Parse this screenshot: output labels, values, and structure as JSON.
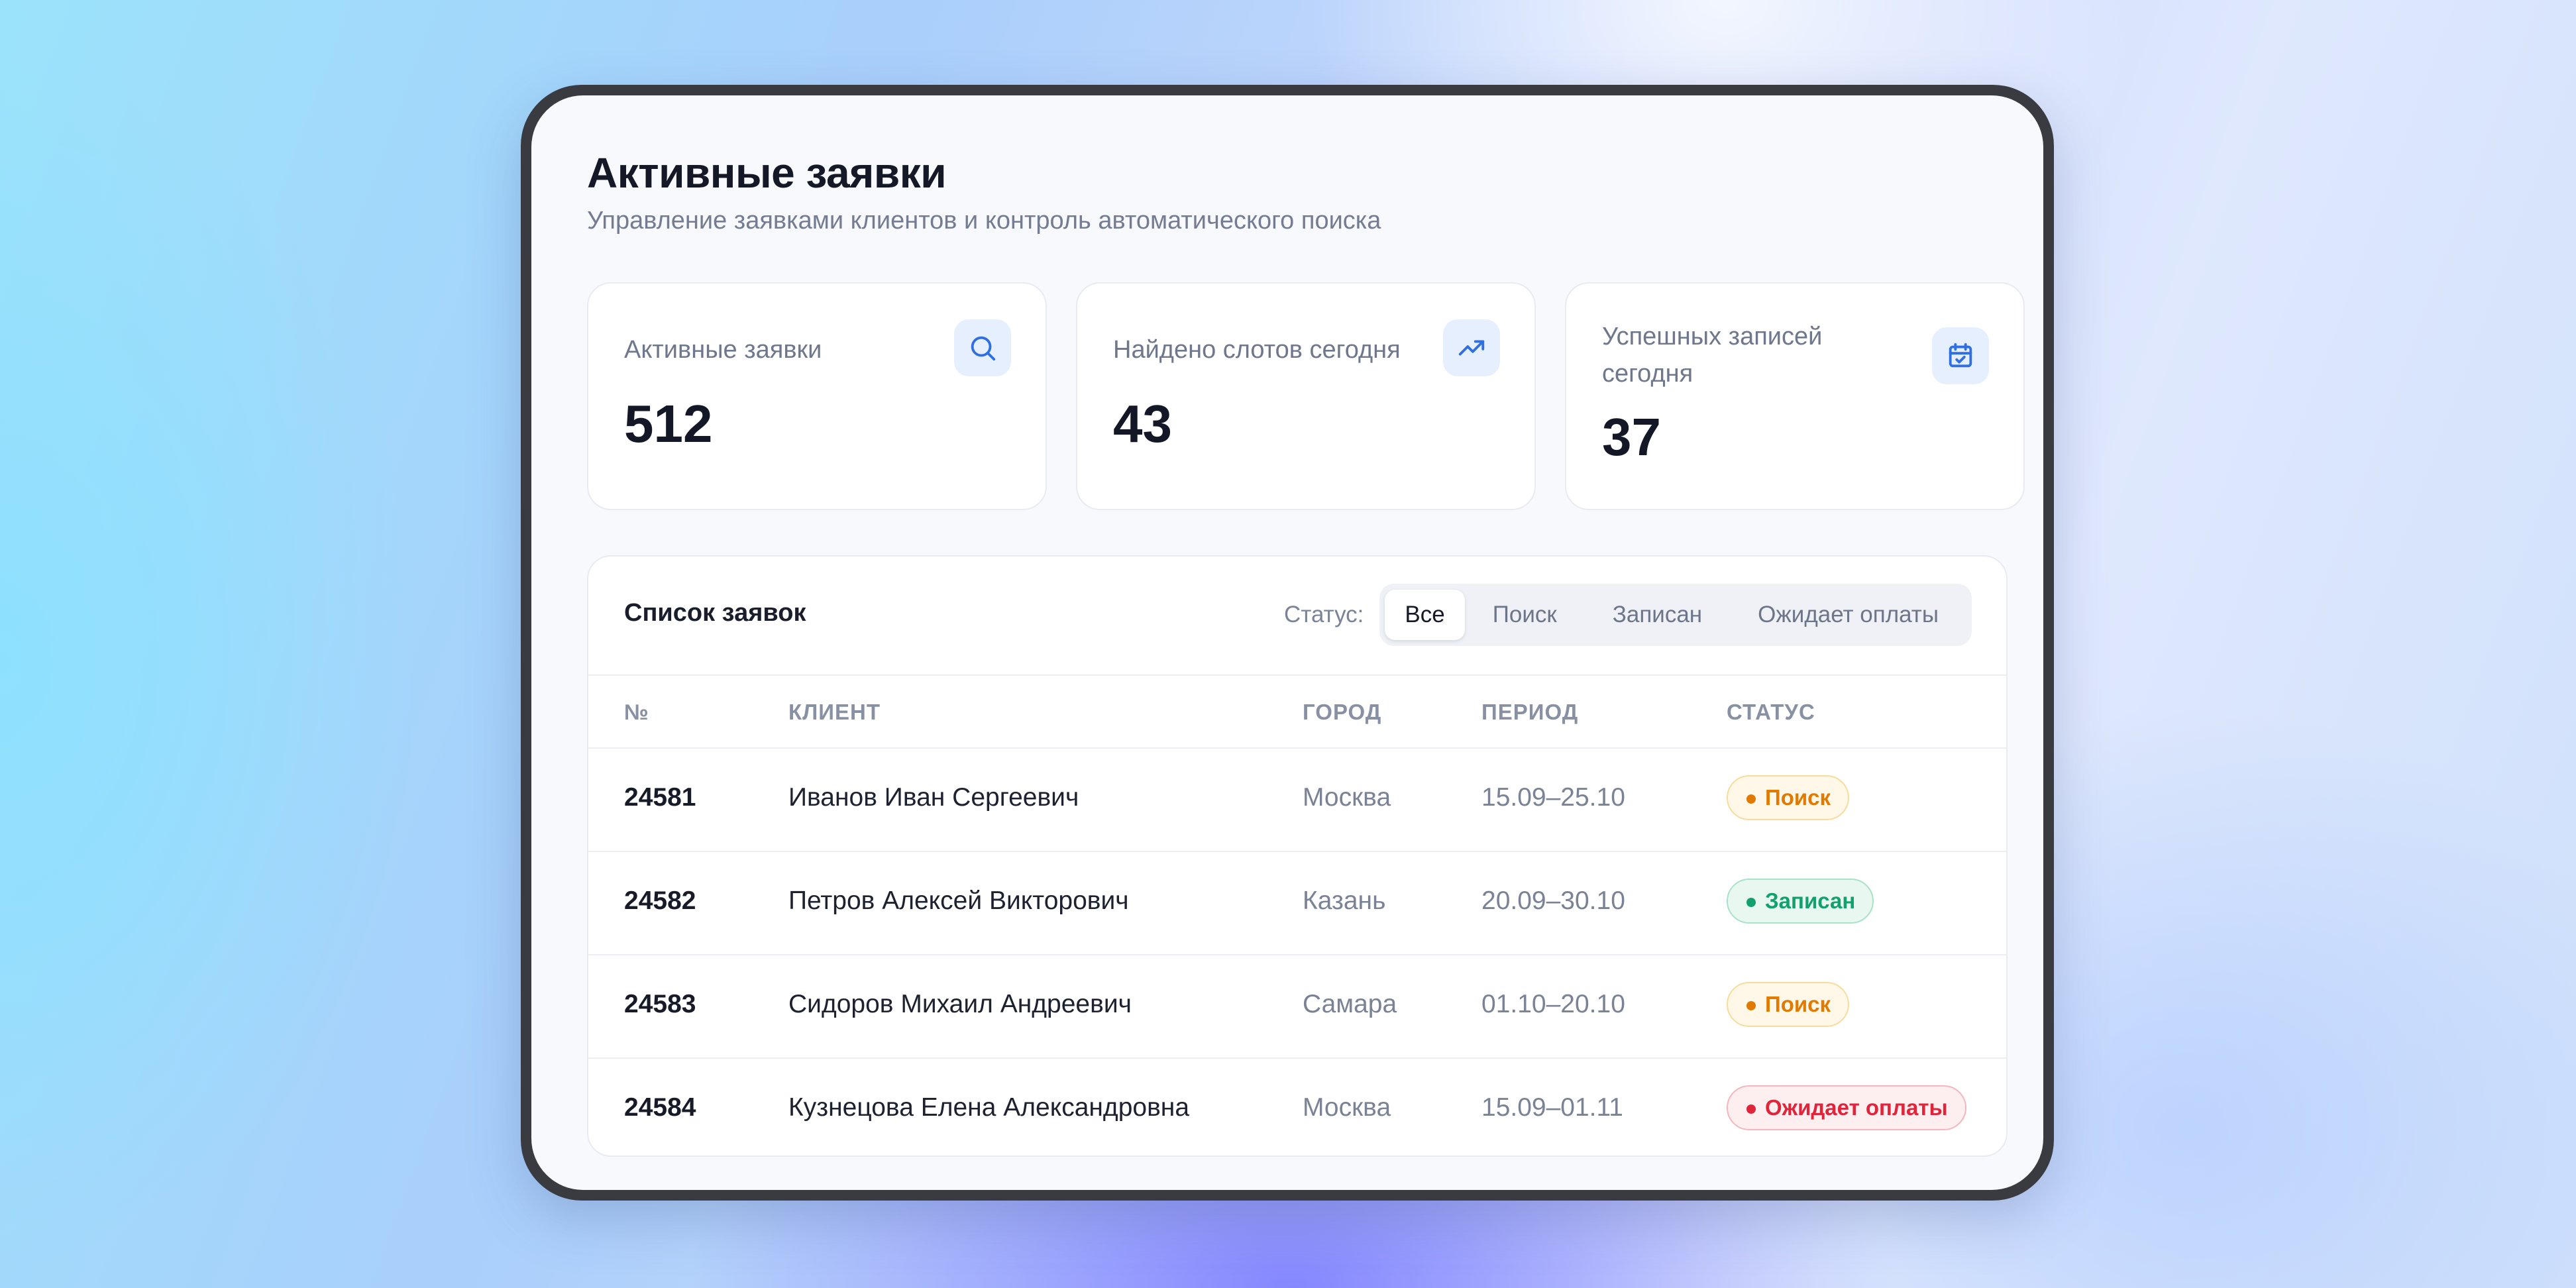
{
  "page": {
    "title": "Активные заявки",
    "subtitle": "Управление заявками клиентов и контроль автоматического поиска"
  },
  "stats": [
    {
      "label": "Активные заявки",
      "value": "512",
      "icon": "search-icon"
    },
    {
      "label": "Найдено слотов сегодня",
      "value": "43",
      "icon": "trending-up-icon"
    },
    {
      "label": "Успешных записей сегодня",
      "value": "37",
      "icon": "calendar-check-icon"
    }
  ],
  "list": {
    "title": "Список заявок",
    "filter_label": "Статус:",
    "filters": [
      {
        "label": "Все",
        "active": true
      },
      {
        "label": "Поиск",
        "active": false
      },
      {
        "label": "Записан",
        "active": false
      },
      {
        "label": "Ожидает оплаты",
        "active": false
      }
    ],
    "columns": [
      "№",
      "КЛИЕНТ",
      "ГОРОД",
      "ПЕРИОД",
      "СТАТУС"
    ],
    "rows": [
      {
        "num": "24581",
        "client": "Иванов Иван Сергеевич",
        "city": "Москва",
        "period": "15.09–25.10",
        "status": "Поиск",
        "status_kind": "search"
      },
      {
        "num": "24582",
        "client": "Петров Алексей Викторович",
        "city": "Казань",
        "period": "20.09–30.10",
        "status": "Записан",
        "status_kind": "booked"
      },
      {
        "num": "24583",
        "client": "Сидоров Михаил Андреевич",
        "city": "Самара",
        "period": "01.10–20.10",
        "status": "Поиск",
        "status_kind": "search"
      },
      {
        "num": "24584",
        "client": "Кузнецова Елена Александровна",
        "city": "Москва",
        "period": "15.09–01.11",
        "status": "Ожидает оплаты",
        "status_kind": "payment"
      }
    ]
  },
  "colors": {
    "accent": "#2f6fe0",
    "status_search": {
      "text": "#e07a00",
      "bg": "#fff8e8",
      "border": "#f8dc9c"
    },
    "status_booked": {
      "text": "#13a070",
      "bg": "#e8f8f1",
      "border": "#a8e2c8"
    },
    "status_payment": {
      "text": "#e0243a",
      "bg": "#fdeef0",
      "border": "#f6b6be"
    }
  }
}
